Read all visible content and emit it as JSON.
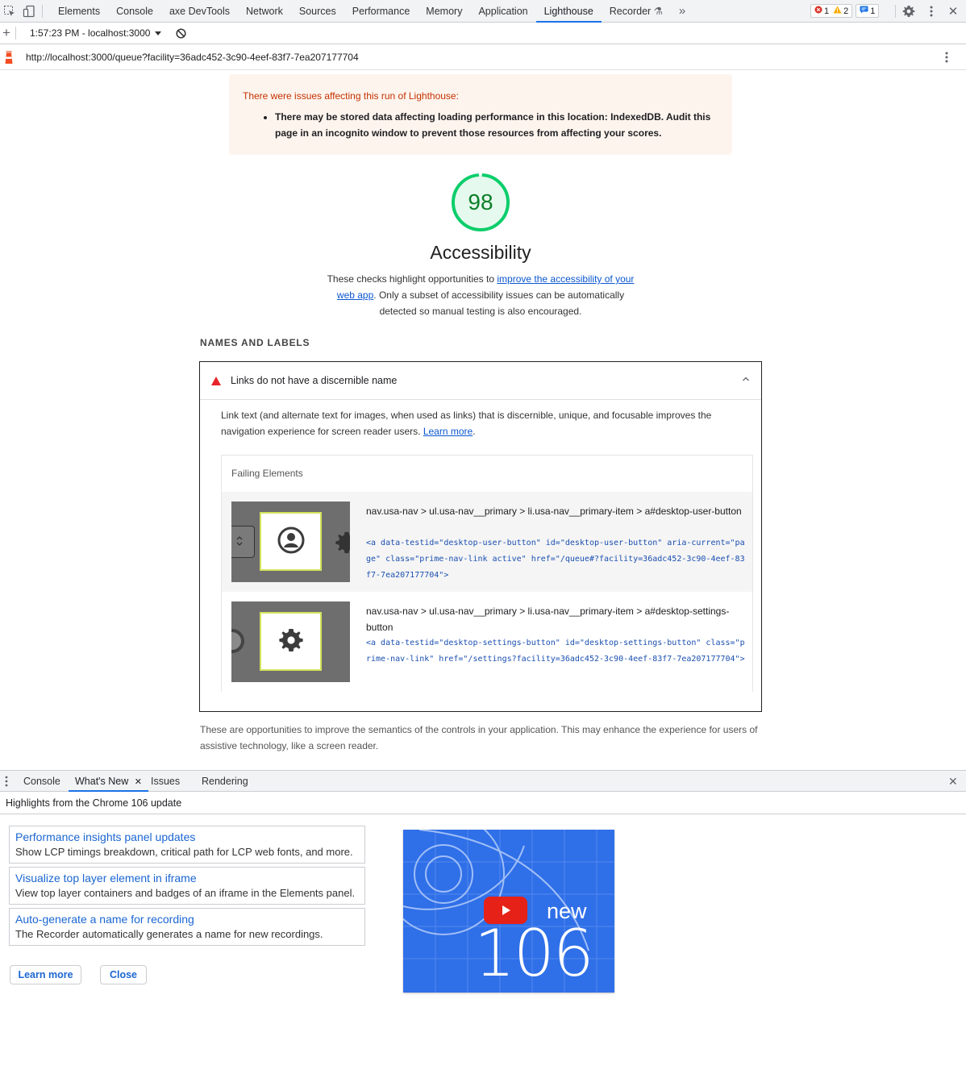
{
  "devtools": {
    "tabs": [
      "Elements",
      "Console",
      "axe DevTools",
      "Network",
      "Sources",
      "Performance",
      "Memory",
      "Application",
      "Lighthouse",
      "Recorder"
    ],
    "active_tab": "Lighthouse",
    "overflow": "»",
    "counts": {
      "errors": "1",
      "warnings": "2",
      "messages": "1"
    },
    "close": "✕"
  },
  "toolbar": {
    "report_select": "1:57:23 PM - localhost:3000",
    "url": "http://localhost:3000/queue?facility=36adc452-3c90-4eef-83f7-7ea207177704"
  },
  "warning": {
    "heading": "There were issues affecting this run of Lighthouse:",
    "item": "There may be stored data affecting loading performance in this location: IndexedDB. Audit this page in an incognito window to prevent those resources from affecting your scores."
  },
  "category": {
    "score": "98",
    "score_value": 0.98,
    "score_color": "#0cce6b",
    "title": "Accessibility",
    "desc_before": "These checks highlight opportunities to ",
    "desc_link": "improve the accessibility of your web app",
    "desc_after": ". Only a subset of accessibility issues can be automatically detected so manual testing is also encouraged."
  },
  "group": {
    "title": "NAMES AND LABELS",
    "footer": "These are opportunities to improve the semantics of the controls in your application. This may enhance the experience for users of assistive technology, like a screen reader."
  },
  "audit": {
    "title": "Links do not have a discernible name",
    "desc_before": "Link text (and alternate text for images, when used as links) that is discernible, unique, and focusable improves the navigation experience for screen reader users. ",
    "learn_more": "Learn more",
    "desc_after": ".",
    "failing_header": "Failing Elements",
    "items": [
      {
        "selector": "nav.usa-nav > ul.usa-nav__primary > li.usa-nav__primary-item > a#desktop-user-button",
        "snippet": "<a data-testid=\"desktop-user-button\" id=\"desktop-user-button\" aria-current=\"page\" class=\"prime-nav-link active\" href=\"/queue#?facility=36adc452-3c90-4eef-83f7-7ea207177704\">"
      },
      {
        "selector": "nav.usa-nav > ul.usa-nav__primary > li.usa-nav__primary-item > a#desktop-settings-button",
        "snippet": "<a data-testid=\"desktop-settings-button\" id=\"desktop-settings-button\" class=\"prime-nav-link\" href=\"/settings?facility=36adc452-3c90-4eef-83f7-7ea207177704\">"
      }
    ]
  },
  "drawer": {
    "tabs": [
      "Console",
      "What's New",
      "Issues",
      "Rendering"
    ],
    "active_tab": "What's New",
    "subtitle": "Highlights from the Chrome 106 update",
    "news": [
      {
        "title": "Performance insights panel updates",
        "desc": "Show LCP timings breakdown, critical path for LCP web fonts, and more."
      },
      {
        "title": "Visualize top layer element in iframe",
        "desc": "View top layer containers and badges of an iframe in the Elements panel."
      },
      {
        "title": "Auto-generate a name for recording",
        "desc": "The Recorder automatically generates a name for new recordings."
      }
    ],
    "learn_more": "Learn more",
    "close": "Close",
    "promo_new": "new",
    "promo_version": "106"
  }
}
